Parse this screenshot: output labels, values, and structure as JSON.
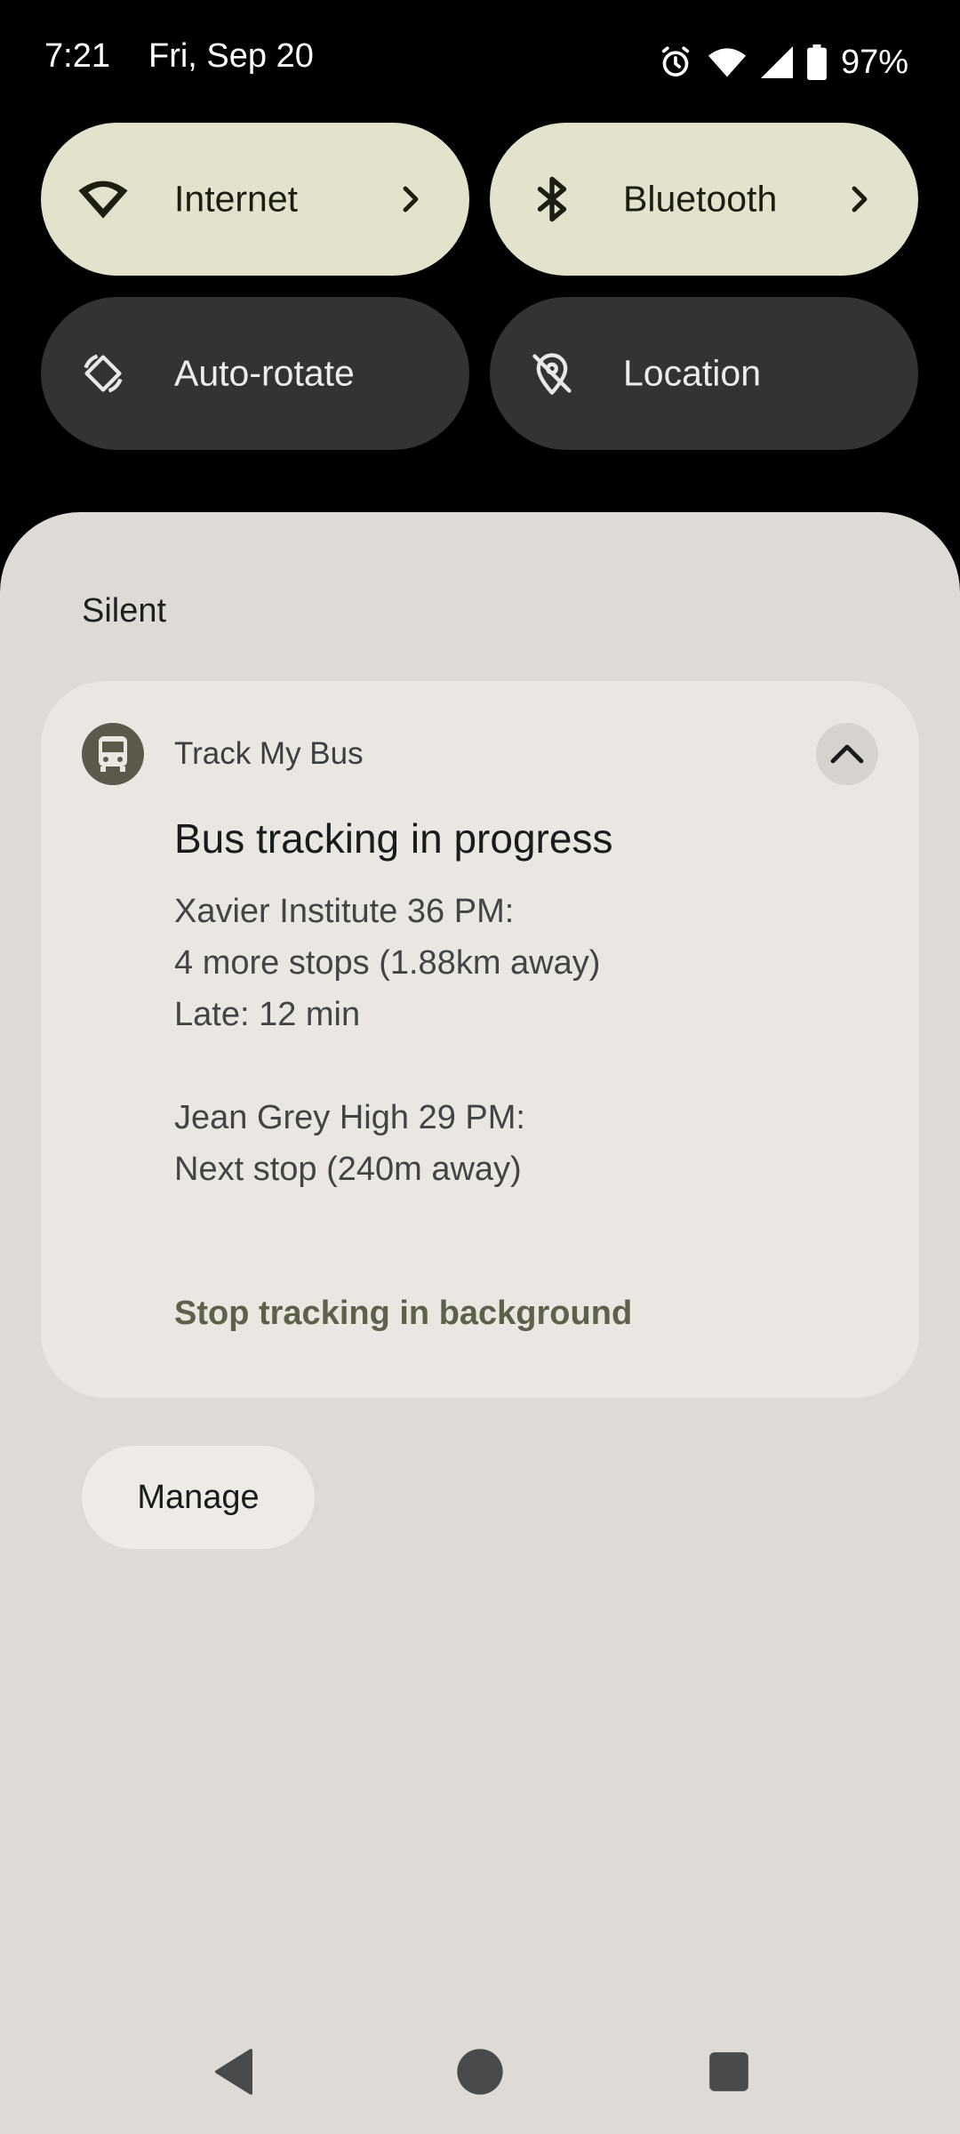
{
  "status_bar": {
    "time": "7:21",
    "date": "Fri, Sep 20",
    "battery": "97%",
    "icons": [
      "alarm-icon",
      "wifi-icon",
      "signal-icon",
      "battery-icon"
    ]
  },
  "quick_tiles": [
    {
      "label": "Internet",
      "icon": "wifi-icon",
      "state": "on",
      "has_chevron": true
    },
    {
      "label": "Bluetooth",
      "icon": "bluetooth-icon",
      "state": "on",
      "has_chevron": true
    },
    {
      "label": "Auto-rotate",
      "icon": "auto-rotate-icon",
      "state": "off",
      "has_chevron": false
    },
    {
      "label": "Location",
      "icon": "location-off-icon",
      "state": "off",
      "has_chevron": false
    }
  ],
  "shade": {
    "section_header": "Silent",
    "notification": {
      "app_name": "Track My Bus",
      "app_icon": "bus-icon",
      "title": "Bus tracking in progress",
      "body_lines": [
        "Xavier Institute 36 PM:",
        "4 more stops (1.88km away)",
        "Late: 12 min",
        "",
        "Jean Grey High 29 PM:",
        "Next stop (240m away)"
      ],
      "action": "Stop tracking in background"
    },
    "manage_label": "Manage"
  },
  "nav_bar": {
    "buttons": [
      "back-icon",
      "home-icon",
      "recents-icon"
    ]
  },
  "colors": {
    "tile_on": "#e3e3cd",
    "tile_off": "#333333",
    "shade_bg": "#dedbd6",
    "card_bg": "#eae7e3",
    "action_text": "#5f604a"
  }
}
